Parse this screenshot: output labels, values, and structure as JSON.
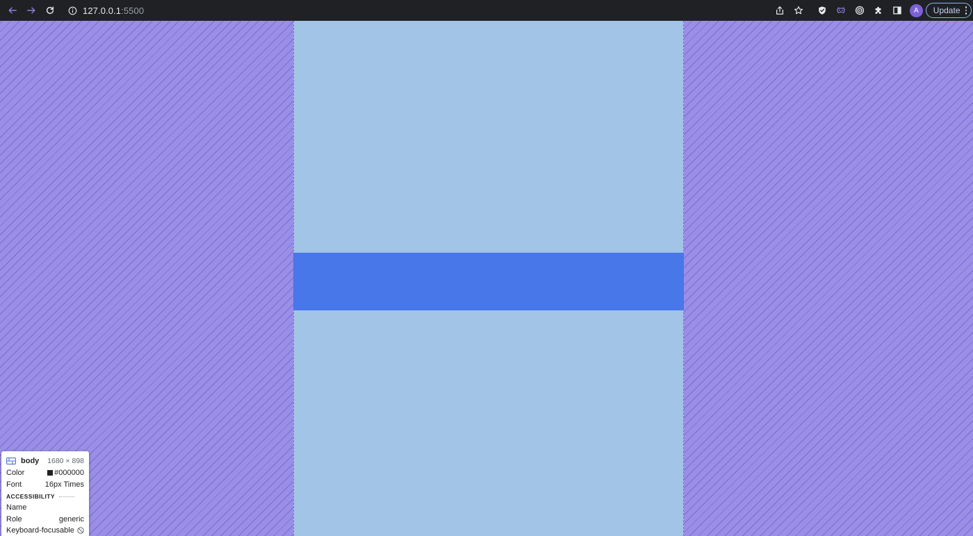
{
  "browser": {
    "url_host": "127.0.0.1",
    "url_port": ":5500",
    "avatar_initial": "A",
    "update_label": "Update"
  },
  "icons": {
    "back": "arrow-left-icon",
    "forward": "arrow-right-icon",
    "reload": "reload-icon",
    "site_info": "info-icon",
    "share": "share-icon",
    "bookmark": "star-icon",
    "shield": "shield-icon",
    "extension_a": "mask-icon",
    "extension_b": "target-icon",
    "extensions": "puzzle-icon",
    "side_panel": "side-panel-icon",
    "menu": "kebab-icon",
    "inspect": "element-icon",
    "not_focusable": "prohibited-icon"
  },
  "colors": {
    "chrome_bg": "#202124",
    "margin": "#9a8ee6",
    "column": "#a2c4e7",
    "band": "#4777e8",
    "accent": "#8ab4f8"
  },
  "inspect": {
    "tag": "body",
    "dimensions": "1680 × 898",
    "color_label": "Color",
    "color_value": "#000000",
    "font_label": "Font",
    "font_value": "16px Times",
    "section_title": "ACCESSIBILITY",
    "name_label": "Name",
    "role_label": "Role",
    "role_value": "generic",
    "focus_label": "Keyboard-focusable"
  }
}
